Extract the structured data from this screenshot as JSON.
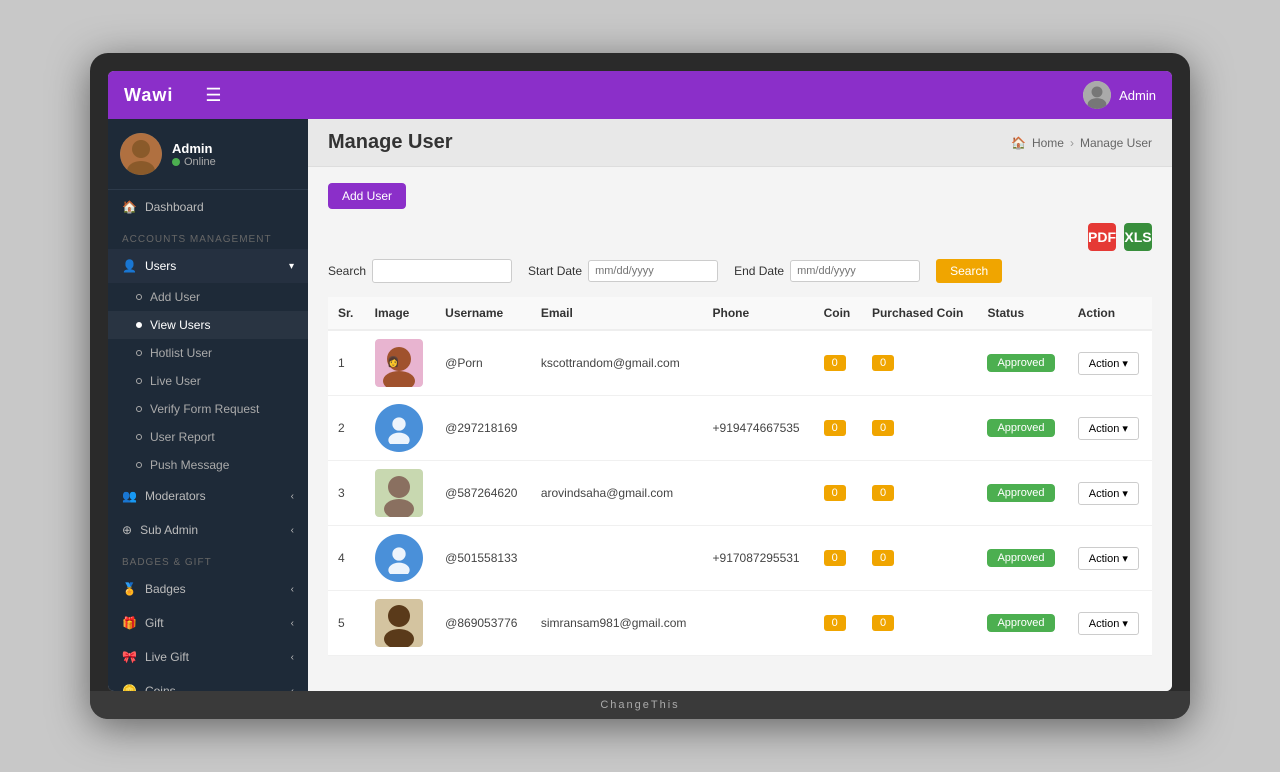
{
  "app": {
    "brand": "Wawi",
    "admin_label": "Admin",
    "laptop_brand": "ChangeThis"
  },
  "breadcrumb": {
    "home": "Home",
    "current": "Manage User"
  },
  "page": {
    "title": "Manage User"
  },
  "sidebar": {
    "profile": {
      "name": "Admin",
      "status": "Online"
    },
    "sections": [
      {
        "label": "ACCOUNTS MANAGEMENT",
        "items": [
          {
            "id": "dashboard",
            "label": "Dashboard",
            "icon": "🏠"
          },
          {
            "id": "users",
            "label": "Users",
            "icon": "👤",
            "expanded": true,
            "children": [
              {
                "id": "add-user",
                "label": "Add User"
              },
              {
                "id": "view-users",
                "label": "View Users",
                "active": true
              },
              {
                "id": "hotlist-user",
                "label": "Hotlist User"
              },
              {
                "id": "live-user",
                "label": "Live User"
              },
              {
                "id": "verify-form-request",
                "label": "Verify Form Request"
              },
              {
                "id": "user-report",
                "label": "User Report"
              },
              {
                "id": "push-message",
                "label": "Push Message"
              }
            ]
          },
          {
            "id": "moderators",
            "label": "Moderators",
            "icon": "👥",
            "hasChevron": true
          },
          {
            "id": "sub-admin",
            "label": "Sub Admin",
            "icon": "⚙️",
            "hasChevron": true
          }
        ]
      },
      {
        "label": "BADGES & GIFT",
        "items": [
          {
            "id": "badges",
            "label": "Badges",
            "icon": "🏅",
            "hasChevron": true
          },
          {
            "id": "gift",
            "label": "Gift",
            "icon": "🎁",
            "hasChevron": true
          },
          {
            "id": "live-gift",
            "label": "Live Gift",
            "icon": "🎀",
            "hasChevron": true
          },
          {
            "id": "coins",
            "label": "Coins",
            "icon": "🪙",
            "hasChevron": true
          }
        ]
      }
    ]
  },
  "toolbar": {
    "add_user_label": "Add User",
    "search_label": "Search",
    "start_date_label": "Start Date",
    "end_date_label": "End Date",
    "search_btn_label": "Search",
    "search_placeholder": "",
    "start_date_placeholder": "mm/dd/yyyy",
    "end_date_placeholder": "mm/dd/yyyy"
  },
  "table": {
    "columns": [
      "Sr.",
      "Image",
      "Username",
      "Email",
      "Phone",
      "Coin",
      "Purchased Coin",
      "Status",
      "Action"
    ],
    "rows": [
      {
        "sr": 1,
        "avatar_type": "image",
        "username": "@Porn",
        "email": "kscottrandom@gmail.com",
        "phone": "",
        "coin": "0",
        "purchased_coin": "0",
        "status": "Approved",
        "action": "Action"
      },
      {
        "sr": 2,
        "avatar_type": "default",
        "username": "@297218169",
        "email": "",
        "phone": "+919474667535",
        "coin": "0",
        "purchased_coin": "0",
        "status": "Approved",
        "action": "Action"
      },
      {
        "sr": 3,
        "avatar_type": "image2",
        "username": "@587264620",
        "email": "arovindsaha@gmail.com",
        "phone": "",
        "coin": "0",
        "purchased_coin": "0",
        "status": "Approved",
        "action": "Action"
      },
      {
        "sr": 4,
        "avatar_type": "default",
        "username": "@501558133",
        "email": "",
        "phone": "+917087295531",
        "coin": "0",
        "purchased_coin": "0",
        "status": "Approved",
        "action": "Action"
      },
      {
        "sr": 5,
        "avatar_type": "image3",
        "username": "@869053776",
        "email": "simransam981@gmail.com",
        "phone": "",
        "coin": "0",
        "purchased_coin": "0",
        "status": "Approved",
        "action": "Action"
      }
    ]
  }
}
